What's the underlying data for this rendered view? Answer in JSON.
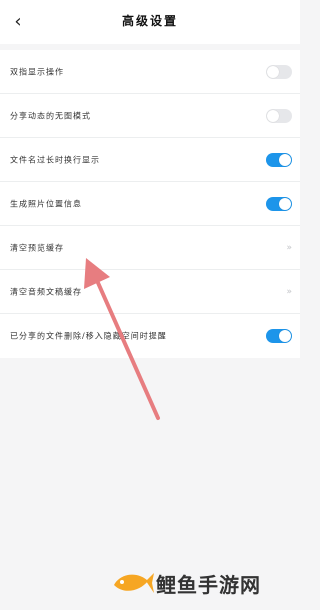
{
  "header": {
    "back_icon": "chevron-left-icon",
    "back_glyph": "‹",
    "title": "高级设置"
  },
  "settings": [
    {
      "label": "双指显示操作",
      "control": "toggle",
      "on": false
    },
    {
      "label": "分享动态的无图模式",
      "control": "toggle",
      "on": false
    },
    {
      "label": "文件名过长时换行显示",
      "control": "toggle",
      "on": true
    },
    {
      "label": "生成照片位置信息",
      "control": "toggle",
      "on": true
    },
    {
      "label": "清空预览缓存",
      "control": "chevron",
      "glyph": "»"
    },
    {
      "label": "清空音频文稿缓存",
      "control": "chevron",
      "glyph": "»"
    },
    {
      "label": "已分享的文件删除/移入隐藏空间时提醒",
      "control": "toggle",
      "on": true
    }
  ],
  "annotation": {
    "type": "red-arrow",
    "color": "#e77d80",
    "points_to": "清空预览缓存"
  },
  "watermark": {
    "text": "鲤鱼手游网",
    "fish_color": "#f6a623"
  },
  "colors": {
    "accent": "#1d95ea",
    "toggle_off": "#e6e7ea",
    "background": "#f5f5f6"
  }
}
